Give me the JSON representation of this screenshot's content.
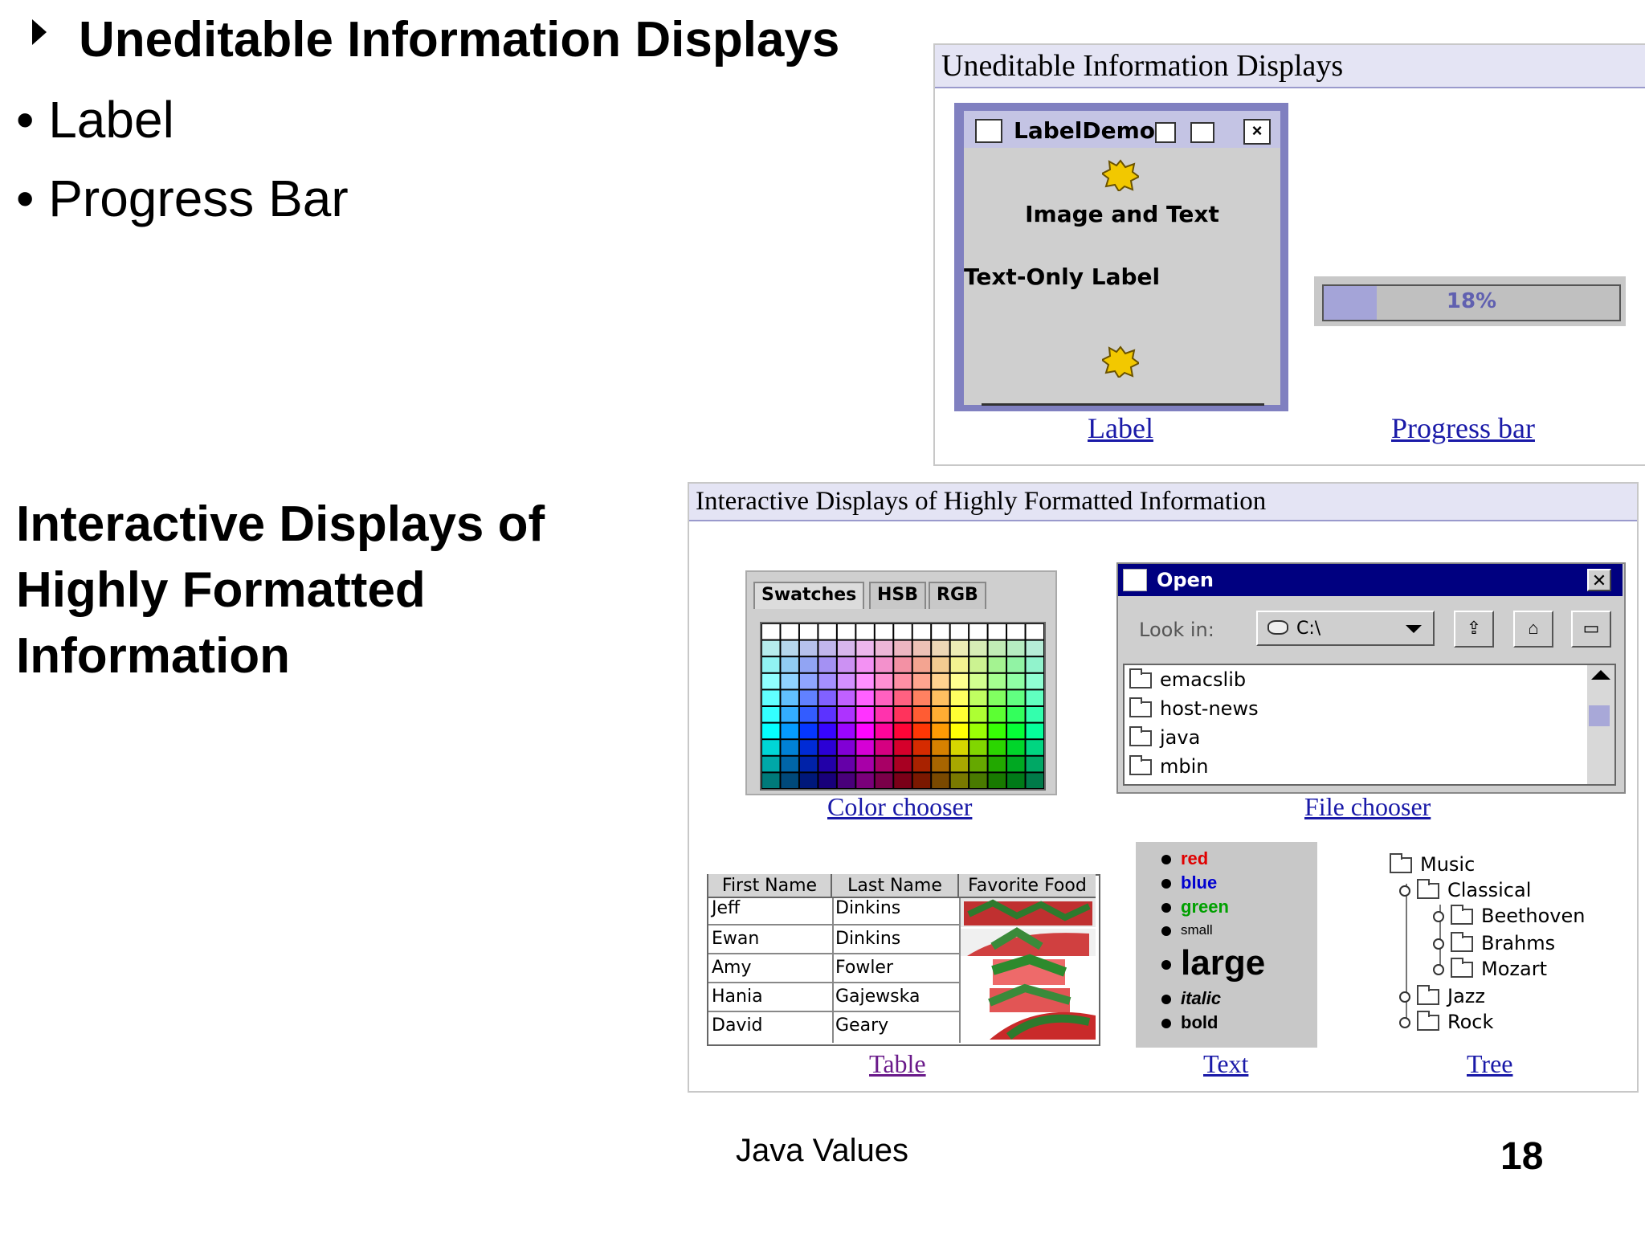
{
  "slide": {
    "heading1": "Uneditable Information Displays",
    "bullets": [
      "Label",
      "Progress Bar"
    ],
    "heading2": "Interactive Displays of Highly Formatted Information",
    "footer_text": "Java Values",
    "page_number": "18"
  },
  "panel_uneditable": {
    "title": "Uneditable Information Displays",
    "label_demo": {
      "window_title": "LabelDemo",
      "image_and_text": "Image and Text",
      "text_only": "Text-Only Label"
    },
    "progress": {
      "value": 0.18,
      "text": "18%"
    },
    "captions": {
      "label": "Label",
      "progress": "Progress bar"
    }
  },
  "panel_interactive": {
    "title": "Interactive Displays of Highly Formatted Information",
    "color_chooser": {
      "tabs": [
        "Swatches",
        "HSB",
        "RGB"
      ],
      "caption": "Color chooser"
    },
    "file_chooser": {
      "title": "Open",
      "look_in_label": "Look in:",
      "look_in_value": "C:\\",
      "close_glyph": "✕",
      "files": [
        "emacslib",
        "host-news",
        "java",
        "mbin"
      ],
      "caption": "File chooser"
    },
    "table": {
      "columns": [
        "First Name",
        "Last Name",
        "Favorite Food"
      ],
      "rows": [
        [
          "Jeff",
          "Dinkins"
        ],
        [
          "Ewan",
          "Dinkins"
        ],
        [
          "Amy",
          "Fowler"
        ],
        [
          "Hania",
          "Gajewska"
        ],
        [
          "David",
          "Geary"
        ]
      ],
      "caption": "Table"
    },
    "text": {
      "items": {
        "red": "red",
        "blue": "blue",
        "green": "green",
        "small": "small",
        "large": "large",
        "italic": "italic",
        "bold": "bold"
      },
      "colors": {
        "red": "#e00000",
        "blue": "#0000d0",
        "green": "#00a000"
      },
      "caption": "Text"
    },
    "tree": {
      "root": "Music",
      "classical": "Classical",
      "beethoven": "Beethoven",
      "brahms": "Brahms",
      "mozart": "Mozart",
      "jazz": "Jazz",
      "rock": "Rock",
      "caption": "Tree"
    }
  }
}
